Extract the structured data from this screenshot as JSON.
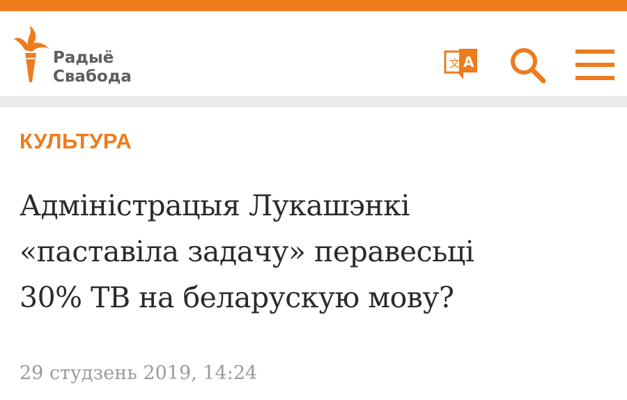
{
  "header": {
    "logo_line1": "Радыё",
    "logo_line2": "Свабода",
    "icons": [
      "translate-icon",
      "search-icon",
      "menu-icon"
    ]
  },
  "article": {
    "category": "КУЛЬТУРА",
    "headline_lines": [
      "Адміністрацыя Лукашэнкі",
      "«паставіла задачу» перавесьці",
      "30% ТВ на беларускую мову?"
    ],
    "date": "29 студзень 2019, 14:24"
  },
  "colors": {
    "accent": "#ee7b1c",
    "logo_text": "#5e5e5e",
    "headline_text": "#2a2a2a",
    "date_text": "#9a9a9a",
    "divider": "#eaeaea"
  }
}
